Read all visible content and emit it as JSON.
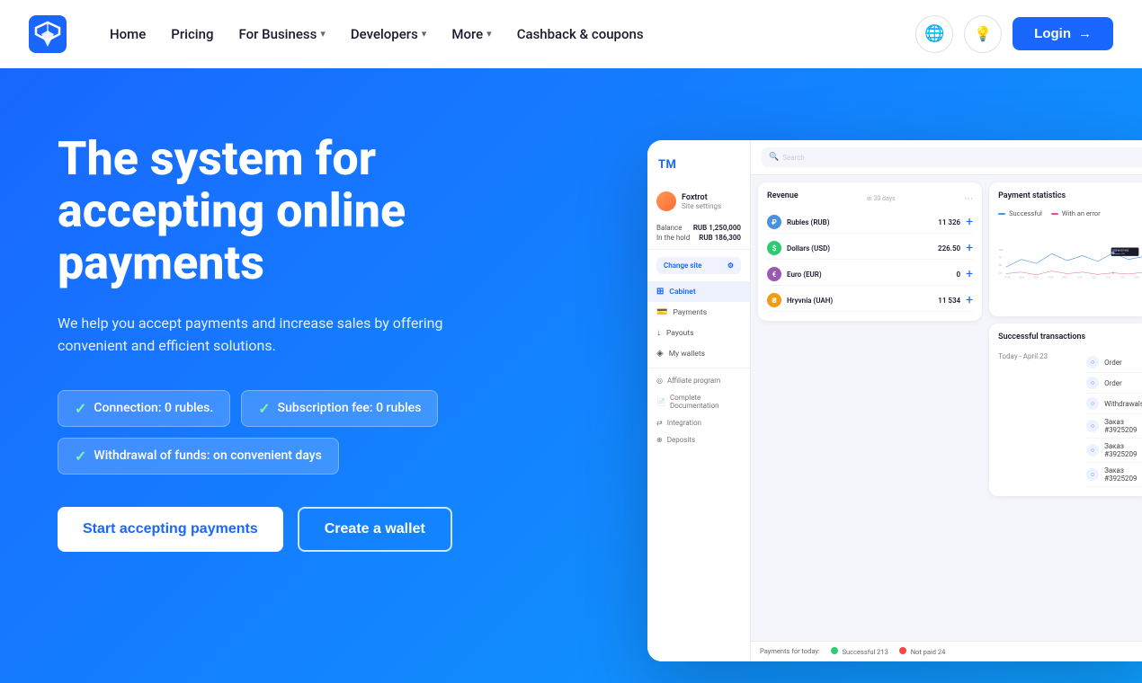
{
  "navbar": {
    "logo_text": "T",
    "links": [
      {
        "label": "Home",
        "has_chevron": false
      },
      {
        "label": "Pricing",
        "has_chevron": false
      },
      {
        "label": "For Business",
        "has_chevron": true
      },
      {
        "label": "Developers",
        "has_chevron": true
      },
      {
        "label": "More",
        "has_chevron": true
      }
    ],
    "cashback_label": "Cashback & coupons",
    "login_label": "Login"
  },
  "hero": {
    "title": "The system for accepting online payments",
    "subtitle": "We help you accept payments and increase sales by offering convenient and efficient solutions.",
    "badges": [
      {
        "text": "Connection: 0 rubles."
      },
      {
        "text": "Subscription fee: 0 rubles"
      },
      {
        "text": "Withdrawal of funds: on convenient days"
      }
    ],
    "cta_primary": "Start accepting payments",
    "cta_secondary": "Create a wallet"
  },
  "dashboard": {
    "logo": "TM",
    "search_placeholder": "Search",
    "site_name": "Foxtrot",
    "site_sub": "Site settings",
    "balance_label": "Balance",
    "balance_val": "RUB 1,250,000",
    "hold_label": "In the hold",
    "hold_val": "RUB 186,300",
    "change_site": "Change site",
    "nav_items": [
      {
        "label": "Cabinet",
        "active": true
      },
      {
        "label": "Payments"
      },
      {
        "label": "Payouts"
      },
      {
        "label": "My wallets"
      }
    ],
    "nav_items2": [
      {
        "label": "Affiliate program"
      },
      {
        "label": "Complete Documentation"
      },
      {
        "label": "Integration"
      },
      {
        "label": "Deposits"
      }
    ],
    "chart_title": "Payment statistics",
    "chart_legend": [
      {
        "label": "Successful",
        "color": "#4a90e2"
      },
      {
        "label": "With an error",
        "color": "#e74c8e"
      }
    ],
    "revenue_title": "Revenue",
    "revenue_period": "in 30 days",
    "tx_title": "Successful transactions",
    "tx_today": "Today - April 23",
    "wallets": [
      {
        "currency": "₽",
        "name": "Rubles (RUB)",
        "amount": "11 326",
        "bg": "#4a90e2",
        "color": "#fff"
      },
      {
        "currency": "$",
        "name": "Dollars (USD)",
        "amount": "226.50",
        "bg": "#2ecc71",
        "color": "#fff"
      },
      {
        "currency": "€",
        "name": "Euro (EUR)",
        "amount": "0",
        "bg": "#9b59b6",
        "color": "#fff"
      },
      {
        "currency": "₴",
        "name": "Hryvnia (UAH)",
        "amount": "11 534",
        "bg": "#f39c12",
        "color": "#fff"
      }
    ],
    "transactions": [
      {
        "label": "Order"
      },
      {
        "label": "Order"
      },
      {
        "label": "Withdrawals"
      },
      {
        "label": "Заказ #3925209"
      },
      {
        "label": "Заказ #3925209"
      },
      {
        "label": "Заказ #3925209"
      }
    ],
    "footer_successful": "Successful 213",
    "footer_not_paid": "Not paid 24",
    "footer_label": "Payments for today:"
  }
}
